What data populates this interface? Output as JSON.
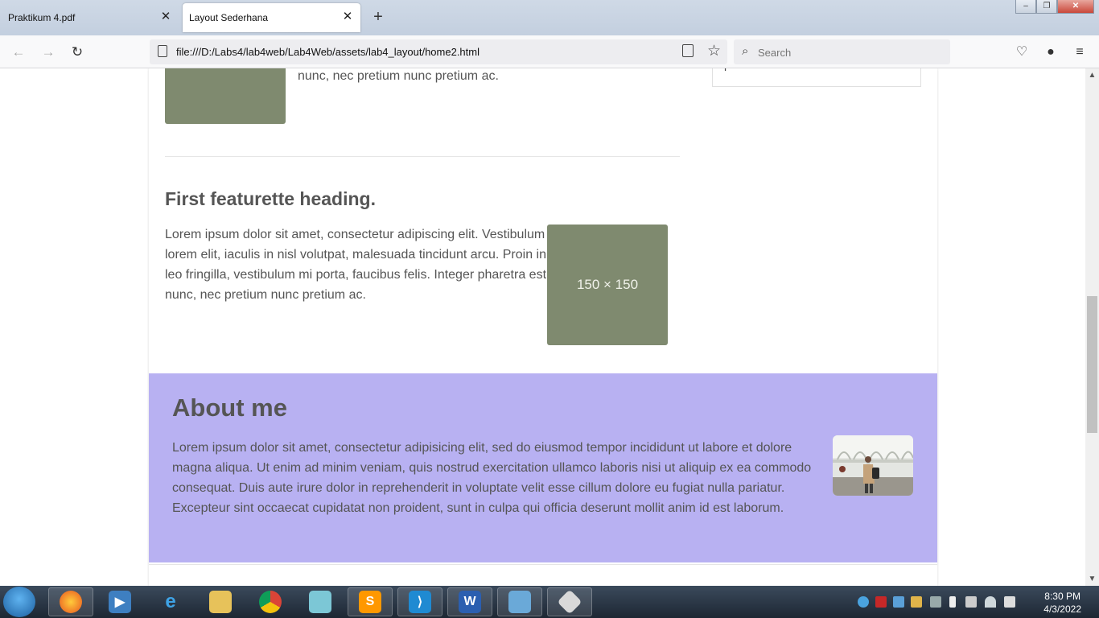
{
  "browser": {
    "tabs": [
      {
        "label": "Praktikum 4.pdf",
        "active": false
      },
      {
        "label": "Layout Sederhana",
        "active": true
      }
    ],
    "url": "file:///D:/Labs4/lab4web/Lab4Web/assets/lab4_layout/home2.html",
    "search_placeholder": "Search",
    "window_controls": {
      "minimize": "–",
      "restore": "❐",
      "close": "✕"
    }
  },
  "page": {
    "top_text": "nunc, nec pretium nunc pretium ac.",
    "sidebar_fragment": "p",
    "featurette": {
      "heading": "First featurette heading.",
      "body": "Lorem ipsum dolor sit amet, consectetur adipiscing elit. Vestibulum lorem elit, iaculis in nisl volutpat, malesuada tincidunt arcu. Proin in leo fringilla, vestibulum mi porta, faucibus felis. Integer pharetra est nunc, nec pretium nunc pretium ac.",
      "image_label": "150 × 150"
    },
    "about": {
      "heading": "About me",
      "body": "Lorem ipsum dolor sit amet, consectetur adipisicing elit, sed do eiusmod tempor incididunt ut labore et dolore magna aliqua. Ut enim ad minim veniam, quis nostrud exercitation ullamco laboris nisi ut aliquip ex ea commodo consequat. Duis aute irure dolor in reprehenderit in voluptate velit esse cillum dolore eu fugiat nulla pariatur. Excepteur sint occaecat cupidatat non proident, sunt in culpa qui officia deserunt mollit anim id est laborum.",
      "background_color": "#b8b1f2"
    }
  },
  "taskbar": {
    "apps": [
      "firefox",
      "media-player",
      "internet-explorer",
      "file-explorer",
      "chrome",
      "notes",
      "sublime-text",
      "vscode",
      "word",
      "photo-viewer",
      "git"
    ],
    "time": "8:30 PM",
    "date": "4/3/2022"
  }
}
